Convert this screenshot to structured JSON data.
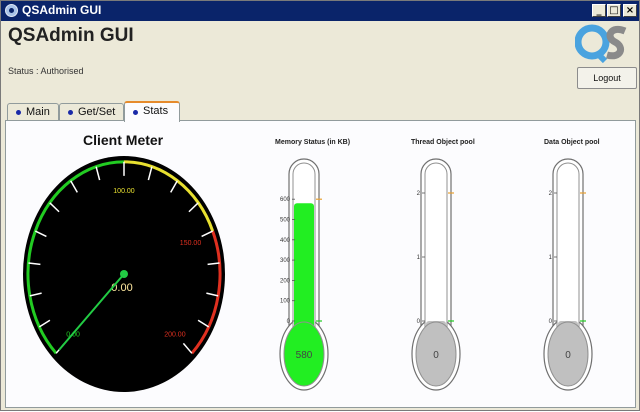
{
  "window": {
    "title": "QSAdmin GUI",
    "minimize_label": "_",
    "maximize_label": "□",
    "close_label": "×"
  },
  "header": {
    "app_title": "QSAdmin GUI",
    "status": "Status : Authorised",
    "logout_label": "Logout"
  },
  "tabs": [
    {
      "label": "Main"
    },
    {
      "label": "Get/Set"
    },
    {
      "label": "Stats"
    }
  ],
  "active_tab": "Stats",
  "client_meter": {
    "title": "Client Meter",
    "value_text": "0.00",
    "value": 0,
    "min": 0,
    "max": 200,
    "tick_labels": [
      "0.00",
      "100.00",
      "150.00",
      "200.00"
    ],
    "colors": {
      "green": "#22cc22",
      "yellow": "#e8e030",
      "red": "#e03020",
      "needle": "#22cc44"
    }
  },
  "thermometers": [
    {
      "title": "Memory Status (in KB)",
      "value": 580,
      "value_text": "580",
      "max": 600,
      "ticks": [
        "0",
        "100",
        "200",
        "300",
        "400",
        "500",
        "600"
      ],
      "fill_color": "#22ee22"
    },
    {
      "title": "Thread Object pool",
      "value": 0,
      "value_text": "0",
      "max": 2,
      "ticks": [
        "0",
        "1",
        "2"
      ],
      "fill_color": "#c0c0c0"
    },
    {
      "title": "Data Object pool",
      "value": 0,
      "value_text": "0",
      "max": 2,
      "ticks": [
        "0",
        "1",
        "2"
      ],
      "fill_color": "#c0c0c0"
    }
  ]
}
